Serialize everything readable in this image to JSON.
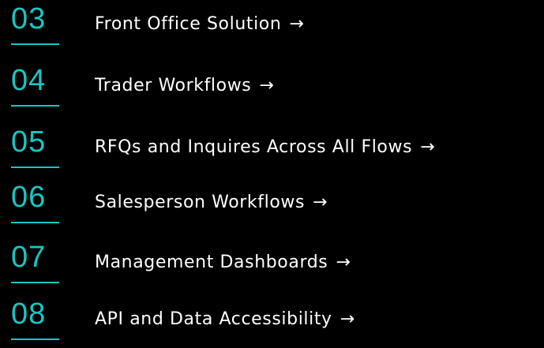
{
  "colors": {
    "background": "#000000",
    "accent": "#19c6c2",
    "text": "#ffffff"
  },
  "toc": {
    "items": [
      {
        "number": "03",
        "label": "Front Office Solution",
        "arrow": "→"
      },
      {
        "number": "04",
        "label": "Trader Workflows",
        "arrow": "→"
      },
      {
        "number": "05",
        "label": "RFQs and Inquires Across All Flows",
        "arrow": "→"
      },
      {
        "number": "06",
        "label": "Salesperson Workflows",
        "arrow": "→"
      },
      {
        "number": "07",
        "label": "Management Dashboards",
        "arrow": "→"
      },
      {
        "number": "08",
        "label": "API and Data Accessibility",
        "arrow": "→"
      }
    ]
  }
}
